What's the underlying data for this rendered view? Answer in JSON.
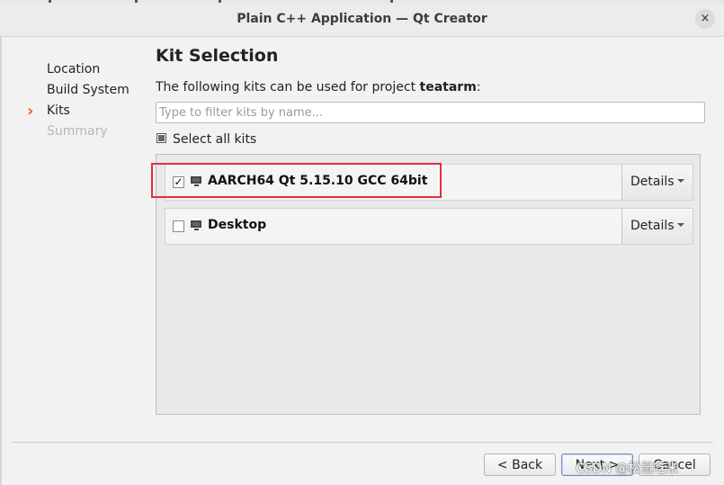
{
  "window": {
    "title": "Plain C++ Application — Qt Creator",
    "close_glyph": "×"
  },
  "steps": [
    {
      "label": "Location"
    },
    {
      "label": "Build System"
    },
    {
      "label": "Kits",
      "current": true
    },
    {
      "label": "Summary",
      "enabled": false
    }
  ],
  "page": {
    "heading": "Kit Selection",
    "description_prefix": "The following kits can be used for project ",
    "project_name": "teatarm",
    "description_suffix": ":",
    "filter_value": "",
    "filter_placeholder": "Type to filter kits by name...",
    "select_all_label": "Select all kits",
    "select_all_state": "partial"
  },
  "kits": [
    {
      "name": "AARCH64 Qt 5.15.10 GCC 64bit",
      "checked": true,
      "check_glyph": "✓",
      "details_label": "Details"
    },
    {
      "name": "Desktop",
      "checked": false,
      "check_glyph": "",
      "details_label": "Details"
    }
  ],
  "buttons": {
    "back": "< Back",
    "next": "Next >",
    "cancel": "Cancel"
  },
  "annotation": {
    "highlight_color": "#e0313a"
  },
  "watermark": "CSDN @松鼠吃米",
  "colors": {
    "accent": "#e0672c",
    "highlight": "#e0313a"
  }
}
